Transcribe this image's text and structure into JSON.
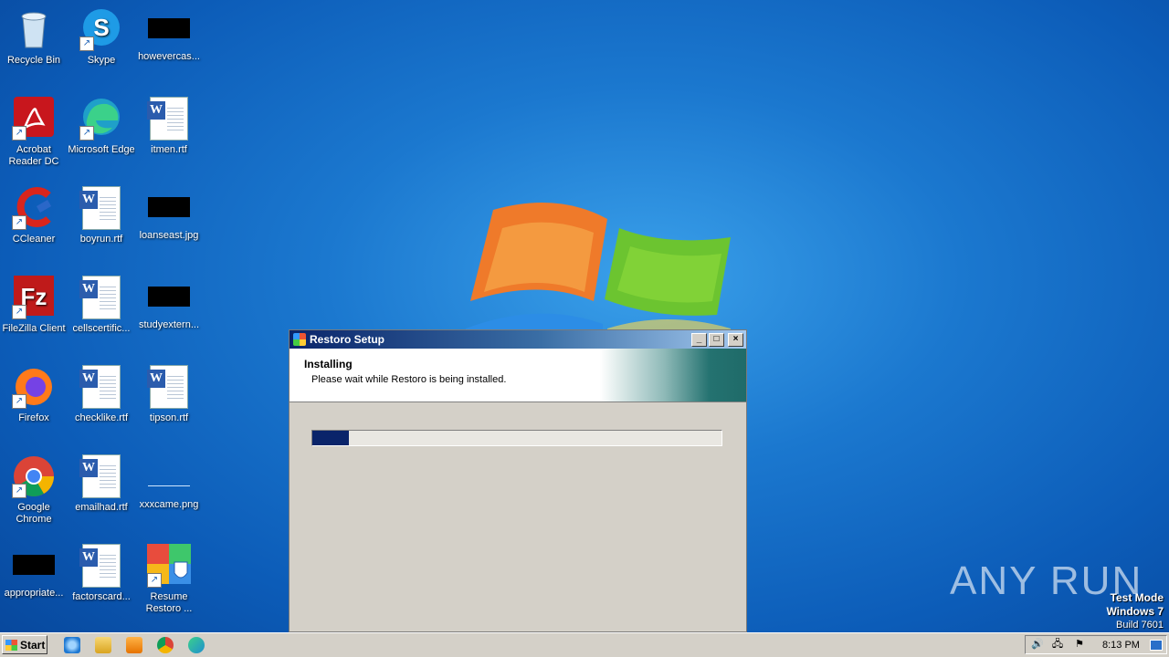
{
  "desktop": {
    "icons": [
      {
        "label": "Recycle Bin",
        "icon": "recycle-bin-icon"
      },
      {
        "label": "Skype",
        "icon": "skype-icon"
      },
      {
        "label": "howevercas...",
        "icon": "image-thumbnail-icon"
      },
      {
        "label": "Acrobat Reader DC",
        "icon": "acrobat-icon"
      },
      {
        "label": "Microsoft Edge",
        "icon": "edge-icon"
      },
      {
        "label": "itmen.rtf",
        "icon": "word-document-icon"
      },
      {
        "label": "CCleaner",
        "icon": "ccleaner-icon"
      },
      {
        "label": "boyrun.rtf",
        "icon": "word-document-icon"
      },
      {
        "label": "loanseast.jpg",
        "icon": "image-thumbnail-icon"
      },
      {
        "label": "FileZilla Client",
        "icon": "filezilla-icon"
      },
      {
        "label": "cellscertific...",
        "icon": "word-document-icon"
      },
      {
        "label": "studyextern...",
        "icon": "image-thumbnail-icon"
      },
      {
        "label": "Firefox",
        "icon": "firefox-icon"
      },
      {
        "label": "checklike.rtf",
        "icon": "word-document-icon"
      },
      {
        "label": "tipson.rtf",
        "icon": "word-document-icon"
      },
      {
        "label": "Google Chrome",
        "icon": "chrome-icon"
      },
      {
        "label": "emailhad.rtf",
        "icon": "word-document-icon"
      },
      {
        "label": "xxxcame.png",
        "icon": "image-thumbnail-icon"
      },
      {
        "label": "appropriate...",
        "icon": "image-thumbnail-icon"
      },
      {
        "label": "factorscard...",
        "icon": "word-document-icon"
      },
      {
        "label": "Resume Restoro ...",
        "icon": "restoro-icon"
      }
    ]
  },
  "installer": {
    "title": "Restoro Setup",
    "heading": "Installing",
    "subtext": "Please wait while Restoro is being installed.",
    "progress": 0.09,
    "buttons": {
      "minimize": "_",
      "maximize": "□",
      "close": "×"
    }
  },
  "watermark": "ANY RUN",
  "system": {
    "mode": "Test Mode",
    "os": "Windows 7",
    "build": "Build 7601"
  },
  "taskbar": {
    "start_label": "Start",
    "quick_launch": [
      "internet-explorer-icon",
      "folder-icon",
      "media-player-icon",
      "chrome-icon",
      "edge-icon"
    ],
    "tray_icons": [
      "volume-icon",
      "network-icon",
      "flag-icon"
    ],
    "clock": "8:13 PM"
  }
}
